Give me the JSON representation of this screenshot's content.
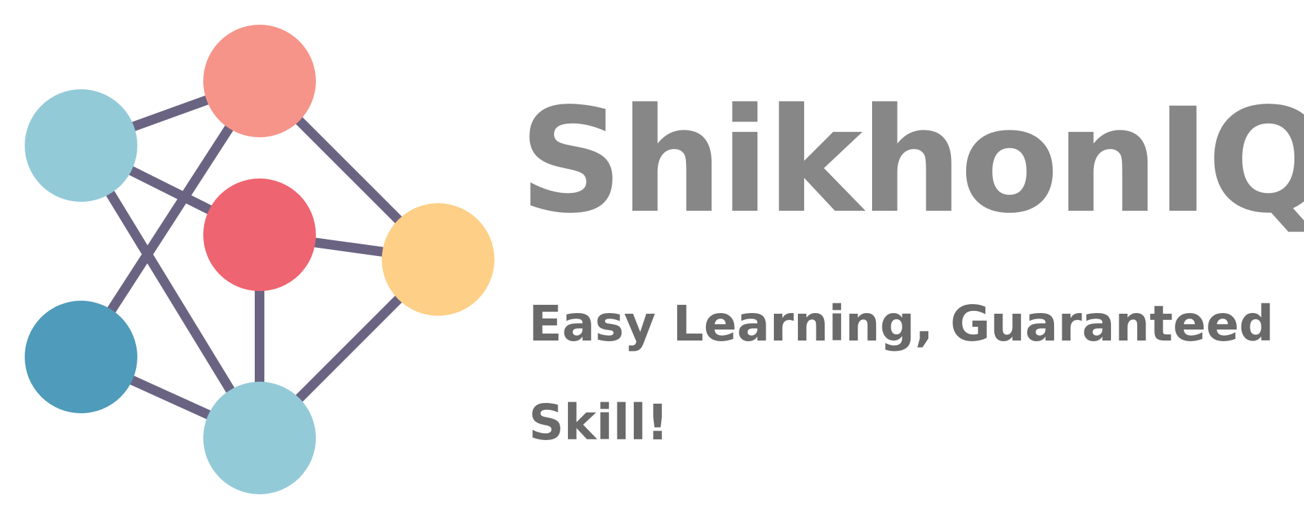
{
  "brand": {
    "name": "ShikhonIQ",
    "tagline": "Easy Learning, Guaranteed Skill!"
  },
  "colors": {
    "brand_text": "#878787",
    "tagline_text": "#6a6a6a",
    "edge": "#6a6482",
    "node_light_blue": "#93cad8",
    "node_salmon": "#f79489",
    "node_red": "#ee6470",
    "node_yellow": "#fecf86",
    "node_teal": "#4f9bbb"
  },
  "icons": {
    "logo": "molecule-network-icon"
  }
}
